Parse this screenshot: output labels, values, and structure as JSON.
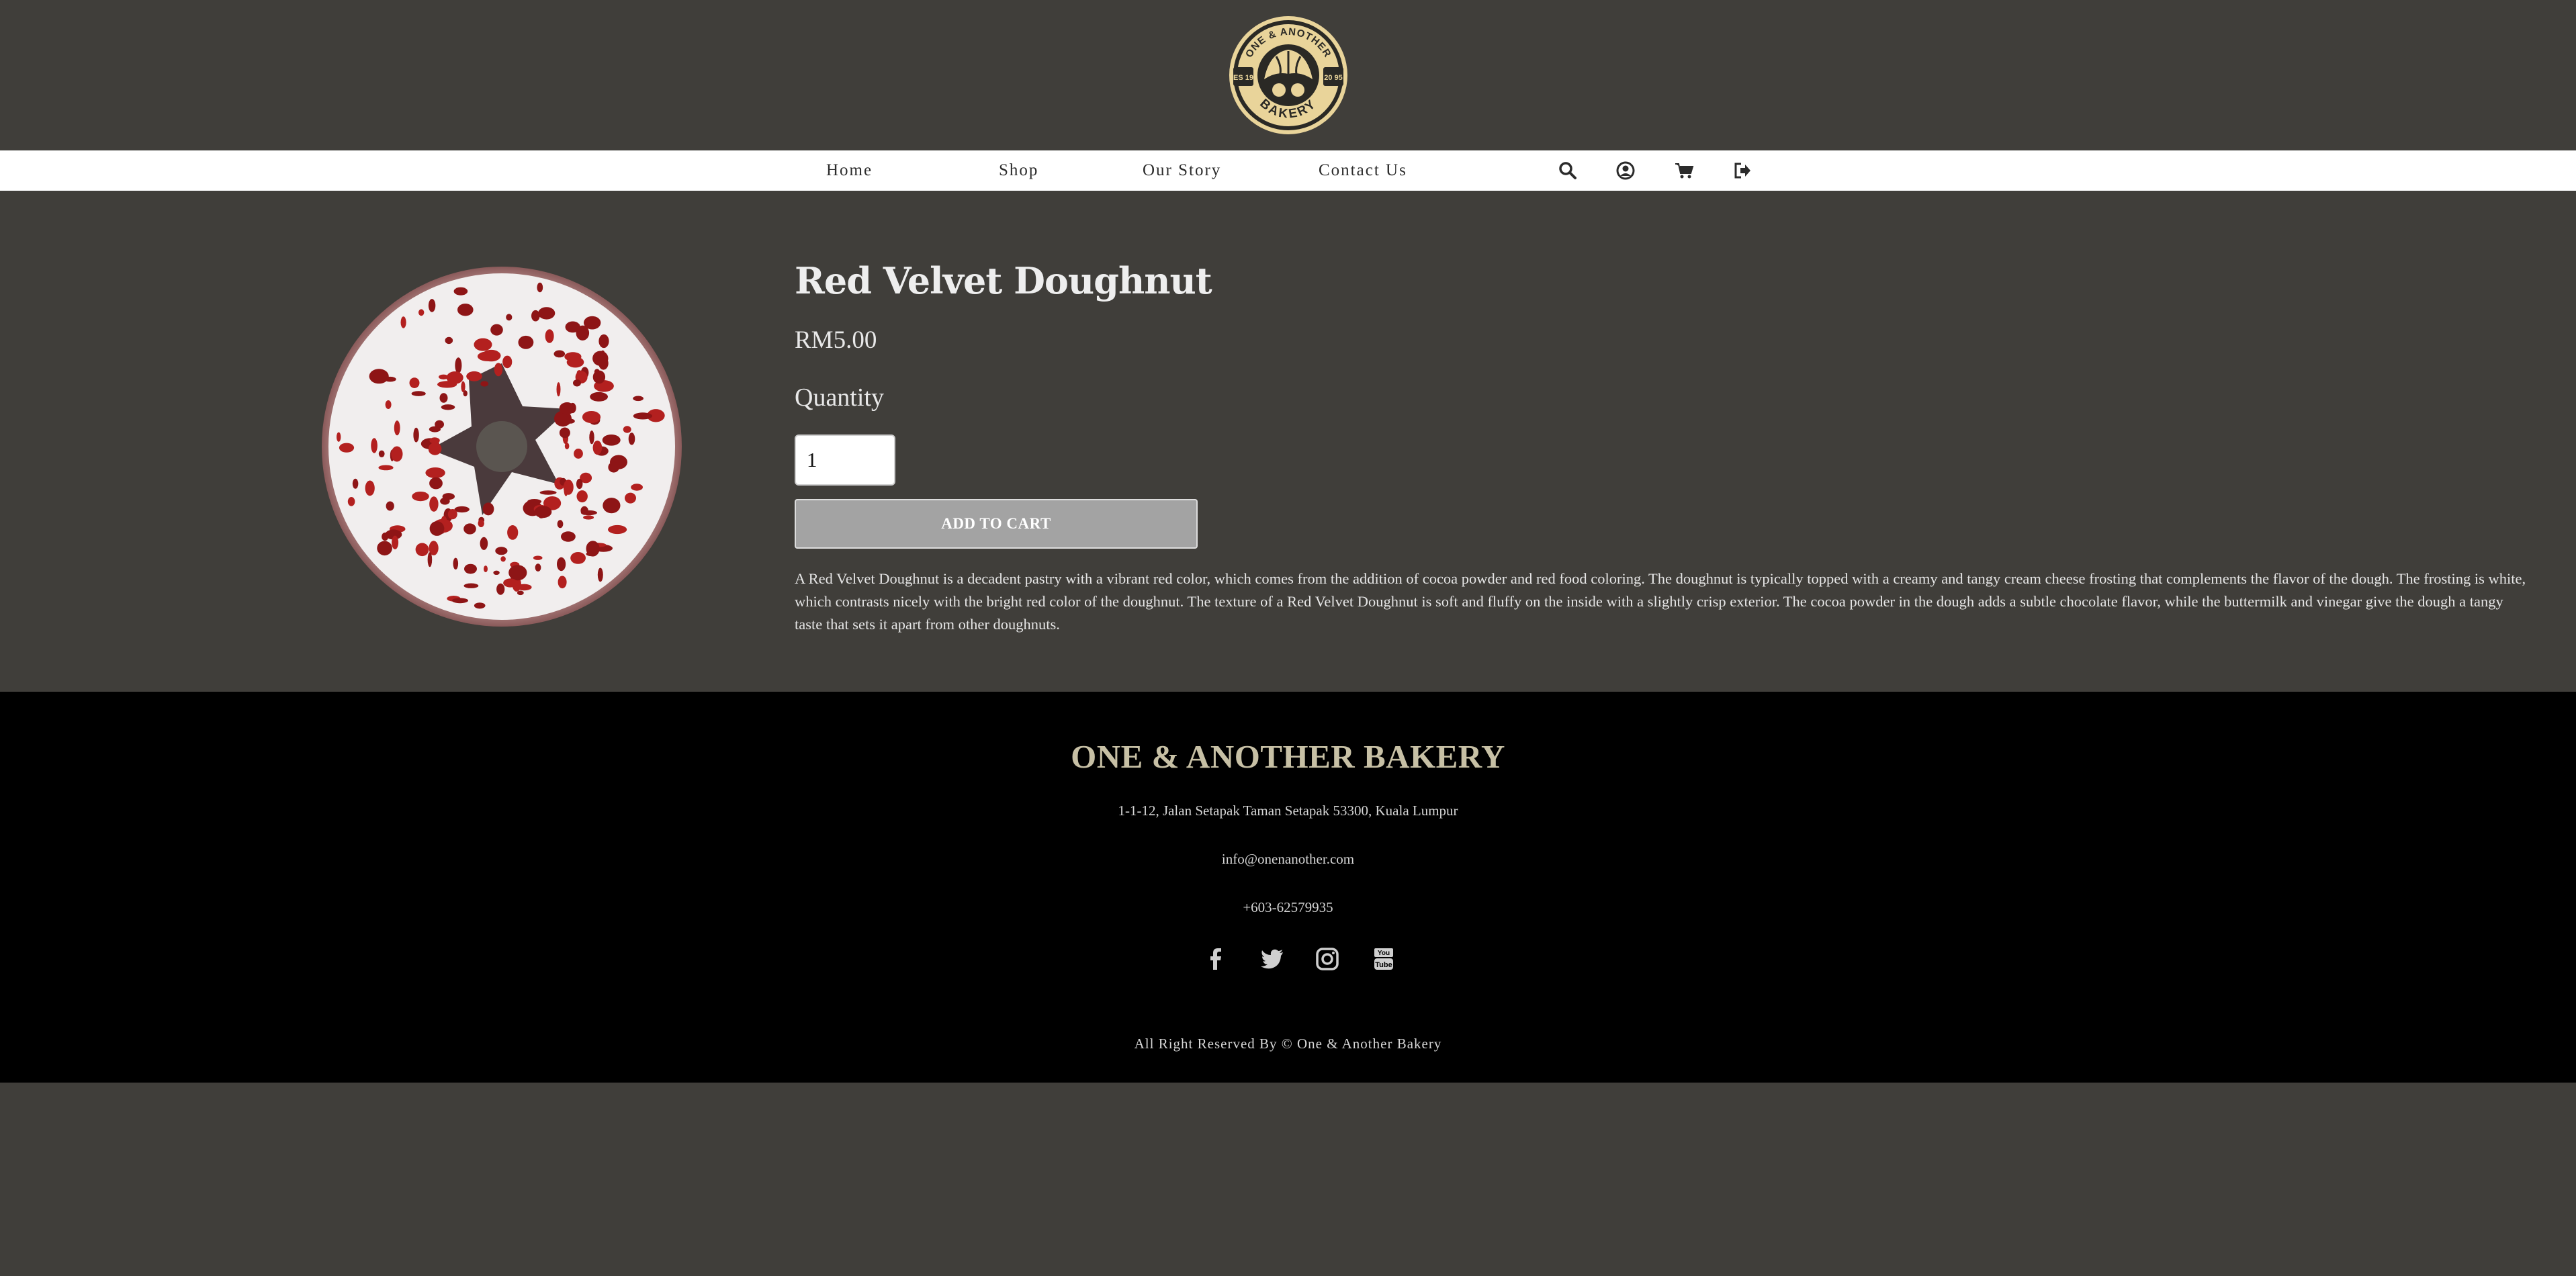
{
  "brand": {
    "logo_icon": "bakery-croissant-badge",
    "logo_ring_text": "ONE & ANOTHER",
    "logo_bottom_text": "BAKERY",
    "logo_side_left": "ES 19",
    "logo_side_right": "20 95"
  },
  "nav": {
    "links": [
      "Home",
      "Shop",
      "Our Story",
      "Contact Us"
    ],
    "icons": [
      "search-icon",
      "user-icon",
      "cart-icon",
      "logout-icon"
    ]
  },
  "product": {
    "image_icon": "red-velvet-doughnut-image",
    "title": "Red Velvet Doughnut",
    "price": "RM5.00",
    "quantity_label": "Quantity",
    "quantity_value": "1",
    "add_to_cart_label": "ADD TO CART",
    "description": "A Red Velvet Doughnut is a decadent pastry with a vibrant red color, which comes from the addition of cocoa powder and red food coloring. The doughnut is typically topped with a creamy and tangy cream cheese frosting that complements the flavor of the dough. The frosting is white, which contrasts nicely with the bright red color of the doughnut. The texture of a Red Velvet Doughnut is soft and fluffy on the inside with a slightly crisp exterior. The cocoa powder in the dough adds a subtle chocolate flavor, while the buttermilk and vinegar give the dough a tangy taste that sets it apart from other doughnuts."
  },
  "footer": {
    "title": "ONE & ANOTHER BAKERY",
    "address": "1-1-12, Jalan Setapak Taman Setapak 53300, Kuala Lumpur",
    "email": "info@onenanother.com",
    "phone": "+603-62579935",
    "socials": [
      "facebook-icon",
      "twitter-icon",
      "instagram-icon",
      "youtube-icon"
    ],
    "copyright": "All Right Reserved By © One & Another Bakery"
  },
  "colors": {
    "page_background": "#403e3a",
    "navbar_background": "#ffffff",
    "footer_background": "#000000",
    "footer_title": "#c7c0a5",
    "button_background": "#a3a3a3"
  }
}
